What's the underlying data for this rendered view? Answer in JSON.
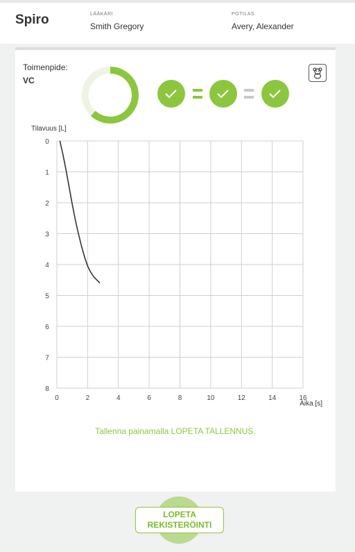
{
  "header": {
    "app_title": "Spiro",
    "doctor_label": "LÄÄKÄRI",
    "doctor_name": "Smith Gregory",
    "patient_label": "POTILAS",
    "patient_name": "Avery, Alexander"
  },
  "procedure": {
    "label": "Toimenpide:",
    "value": "VC"
  },
  "progress": {
    "fraction": 0.62
  },
  "checks": {
    "items": [
      "check",
      "check",
      "check"
    ],
    "separator": "="
  },
  "chart_data": {
    "type": "line",
    "ylabel": "Tilavuus [L]",
    "xlabel": "Aika [s]",
    "xlim": [
      0,
      16
    ],
    "ylim": [
      0,
      8
    ],
    "y_inverted": true,
    "x_ticks": [
      0,
      2,
      4,
      6,
      8,
      10,
      12,
      14,
      16
    ],
    "y_ticks": [
      0,
      1,
      2,
      3,
      4,
      5,
      6,
      7,
      8
    ],
    "grid": true,
    "series": [
      {
        "x": [
          0.2,
          0.4,
          0.6,
          0.8,
          1.0,
          1.2,
          1.4,
          1.6,
          1.8,
          2.0,
          2.2,
          2.4,
          2.6,
          2.8
        ],
        "y": [
          0.0,
          0.45,
          0.95,
          1.5,
          2.05,
          2.55,
          3.0,
          3.4,
          3.75,
          4.05,
          4.25,
          4.4,
          4.5,
          4.6
        ]
      }
    ]
  },
  "status_message": "Tallenna painamalla LOPETA TALLENNUS.",
  "stop_button": {
    "line1": "LOPETA",
    "line2": "REKISTERÖINTI"
  },
  "colors": {
    "accent": "#8cc63f",
    "separator": "#c8c8c8"
  },
  "icons": {
    "kid_mode": "teddy-bear-icon"
  }
}
